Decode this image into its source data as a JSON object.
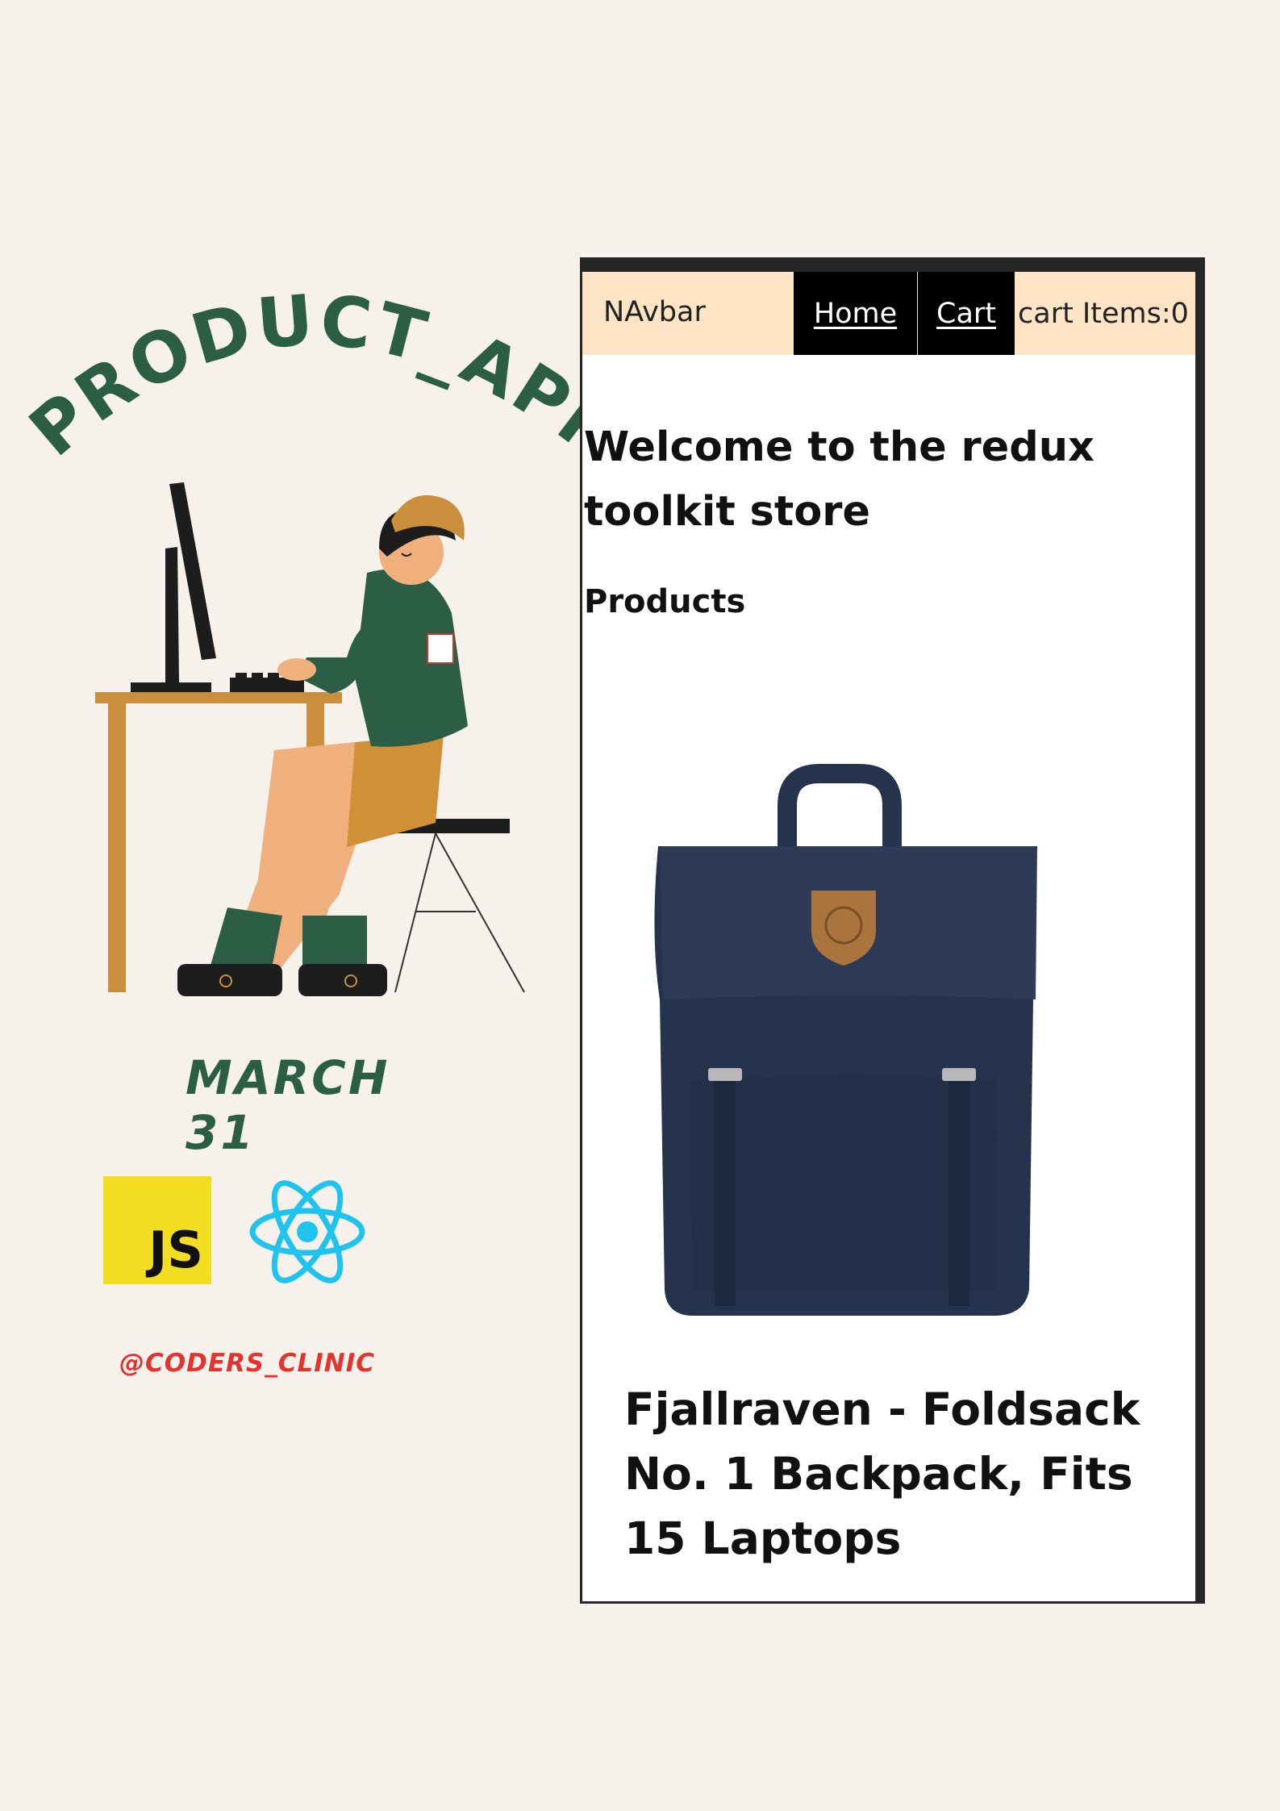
{
  "poster": {
    "title": "PRODUCT_APP",
    "date": "MARCH 31",
    "js_logo_text": "JS",
    "handle": "@CODERS_CLINIC"
  },
  "browser": {
    "navbar": {
      "brand": "NAvbar",
      "home_label": "Home",
      "cart_label": "Cart",
      "cart_items": "cart Items:0"
    },
    "welcome": "Welcome to the redux toolkit store",
    "products_heading": "Products",
    "product": {
      "title": "Fjallraven - Foldsack No. 1 Backpack, Fits 15 Laptops"
    }
  },
  "colors": {
    "background": "#f6f1ea",
    "title_green": "#2c5e45",
    "handle_red": "#e4332f",
    "js_yellow": "#f3dd20",
    "react_blue": "#1fc3ee",
    "navbar_bg": "#fde4c5",
    "backpack_navy": "#26334d"
  },
  "icons": [
    "javascript-logo-icon",
    "react-logo-icon",
    "backpack-image",
    "developer-illustration"
  ]
}
